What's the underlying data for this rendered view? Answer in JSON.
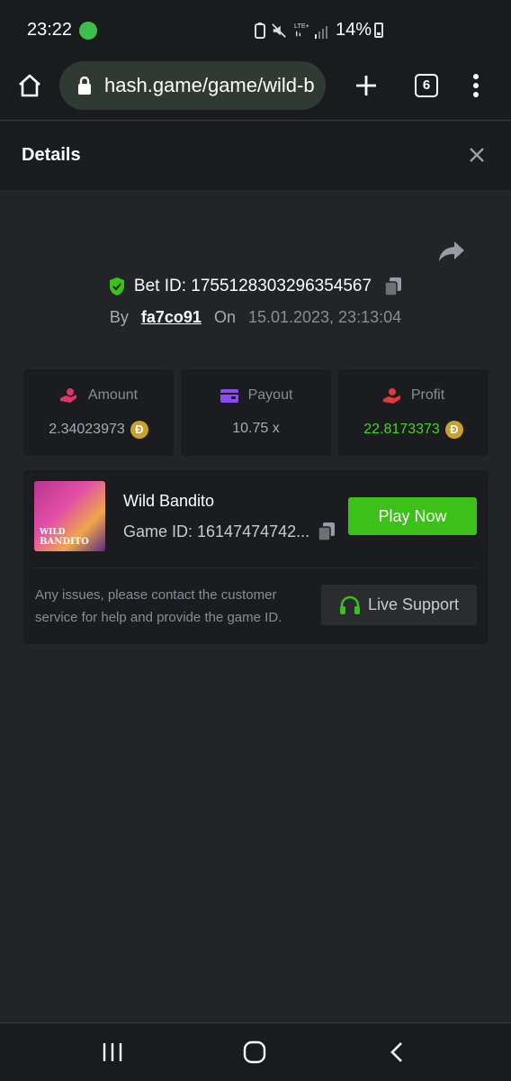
{
  "status_bar": {
    "time": "23:22",
    "battery": "14%"
  },
  "browser": {
    "url": "hash.game/game/wild-b",
    "tab_count": "6"
  },
  "header": {
    "title": "Details"
  },
  "bet": {
    "bet_id": "Bet ID: 1755128303296354567",
    "by_label": "By",
    "user": "fa7co91",
    "on_label": "On",
    "date": "15.01.2023, 23:13:04"
  },
  "stats": [
    {
      "label": "Amount",
      "value": "2.34023973",
      "icon": "coin-hand-icon",
      "color": "#e0356b"
    },
    {
      "label": "Payout",
      "value": "10.75 x",
      "icon": "wallet-icon",
      "color": "#8a4df0"
    },
    {
      "label": "Profit",
      "value": "22.8173373",
      "icon": "profit-hand-icon",
      "color": "#e23a3a"
    }
  ],
  "coin_symbol": "Ɖ",
  "game": {
    "name": "Wild Bandito",
    "game_id": "Game ID: 16147474742...",
    "thumb_line1": "WILD",
    "thumb_line2": "BANDITO",
    "play_label": "Play Now",
    "issues_text": "Any issues, please contact the customer service for help and provide the game ID.",
    "support_label": "Live Support"
  },
  "colors": {
    "accent_green": "#3bc117",
    "profit_green": "#4bd12c",
    "background": "#232428",
    "card": "#1b1c1f"
  }
}
